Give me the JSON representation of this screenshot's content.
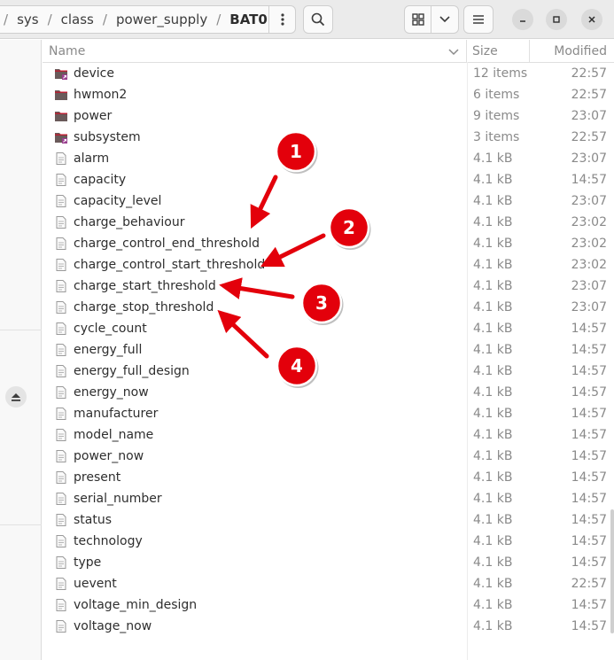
{
  "breadcrumb": {
    "segments": [
      "sys",
      "class",
      "power_supply",
      "BAT0"
    ],
    "separator": "/"
  },
  "toolbar": {
    "menu_icon": "kebab-icon",
    "search_icon": "search-icon",
    "view_icon": "grid-icon",
    "view_dropdown_icon": "chevron-down-icon",
    "hamburger_icon": "hamburger-icon"
  },
  "window_controls": [
    "minimize-icon",
    "maximize-icon",
    "close-icon"
  ],
  "columns": {
    "name": "Name",
    "size": "Size",
    "modified": "Modified"
  },
  "files": [
    {
      "name": "device",
      "size": "12 items",
      "modified": "22:57",
      "type": "folder-link"
    },
    {
      "name": "hwmon2",
      "size": "6 items",
      "modified": "22:57",
      "type": "folder"
    },
    {
      "name": "power",
      "size": "9 items",
      "modified": "23:07",
      "type": "folder"
    },
    {
      "name": "subsystem",
      "size": "3 items",
      "modified": "22:57",
      "type": "folder-link"
    },
    {
      "name": "alarm",
      "size": "4.1 kB",
      "modified": "23:07",
      "type": "file"
    },
    {
      "name": "capacity",
      "size": "4.1 kB",
      "modified": "14:57",
      "type": "file"
    },
    {
      "name": "capacity_level",
      "size": "4.1 kB",
      "modified": "23:07",
      "type": "file"
    },
    {
      "name": "charge_behaviour",
      "size": "4.1 kB",
      "modified": "23:02",
      "type": "file"
    },
    {
      "name": "charge_control_end_threshold",
      "size": "4.1 kB",
      "modified": "23:02",
      "type": "file"
    },
    {
      "name": "charge_control_start_threshold",
      "size": "4.1 kB",
      "modified": "23:02",
      "type": "file"
    },
    {
      "name": "charge_start_threshold",
      "size": "4.1 kB",
      "modified": "23:07",
      "type": "file"
    },
    {
      "name": "charge_stop_threshold",
      "size": "4.1 kB",
      "modified": "23:07",
      "type": "file"
    },
    {
      "name": "cycle_count",
      "size": "4.1 kB",
      "modified": "14:57",
      "type": "file"
    },
    {
      "name": "energy_full",
      "size": "4.1 kB",
      "modified": "14:57",
      "type": "file"
    },
    {
      "name": "energy_full_design",
      "size": "4.1 kB",
      "modified": "14:57",
      "type": "file"
    },
    {
      "name": "energy_now",
      "size": "4.1 kB",
      "modified": "14:57",
      "type": "file"
    },
    {
      "name": "manufacturer",
      "size": "4.1 kB",
      "modified": "14:57",
      "type": "file"
    },
    {
      "name": "model_name",
      "size": "4.1 kB",
      "modified": "14:57",
      "type": "file"
    },
    {
      "name": "power_now",
      "size": "4.1 kB",
      "modified": "14:57",
      "type": "file"
    },
    {
      "name": "present",
      "size": "4.1 kB",
      "modified": "14:57",
      "type": "file"
    },
    {
      "name": "serial_number",
      "size": "4.1 kB",
      "modified": "14:57",
      "type": "file"
    },
    {
      "name": "status",
      "size": "4.1 kB",
      "modified": "14:57",
      "type": "file"
    },
    {
      "name": "technology",
      "size": "4.1 kB",
      "modified": "14:57",
      "type": "file"
    },
    {
      "name": "type",
      "size": "4.1 kB",
      "modified": "14:57",
      "type": "file"
    },
    {
      "name": "uevent",
      "size": "4.1 kB",
      "modified": "22:57",
      "type": "file"
    },
    {
      "name": "voltage_min_design",
      "size": "4.1 kB",
      "modified": "14:57",
      "type": "file"
    },
    {
      "name": "voltage_now",
      "size": "4.1 kB",
      "modified": "14:57",
      "type": "file"
    }
  ],
  "annotations": [
    {
      "label": "1",
      "points_to": "charge_behaviour"
    },
    {
      "label": "2",
      "points_to": "charge_control_start_threshold"
    },
    {
      "label": "3",
      "points_to": "charge_start_threshold"
    },
    {
      "label": "4",
      "points_to": "charge_stop_threshold"
    }
  ],
  "colors": {
    "annotation_red": "#e3000b",
    "folder_dark": "#6a5a5a",
    "folder_accent": "#c7162b",
    "link_badge": "#9a3f8f",
    "muted_text": "#8a8a8a"
  }
}
